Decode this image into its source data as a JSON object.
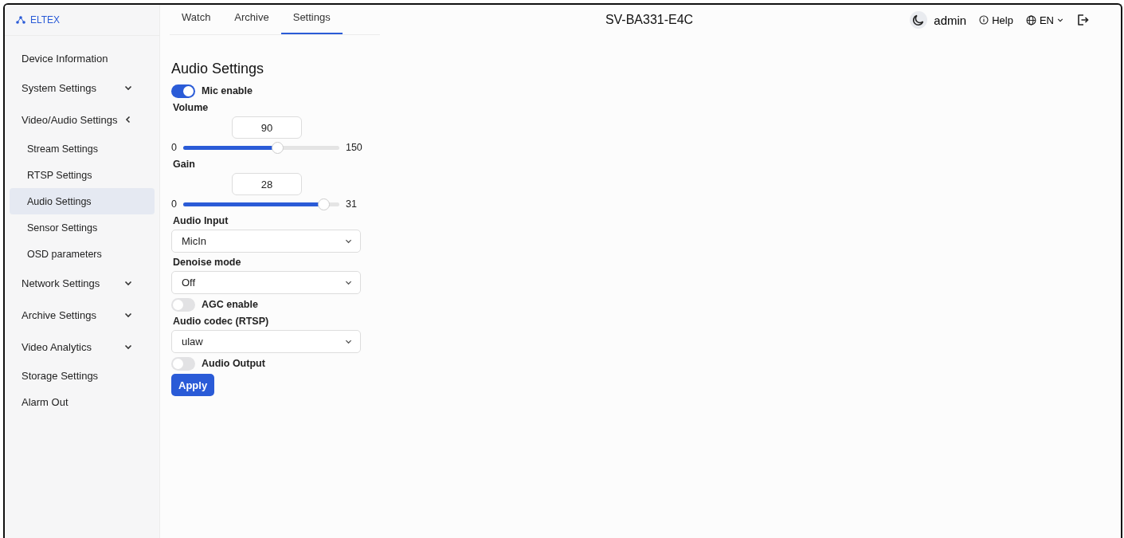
{
  "brand": "ELTEX",
  "tabs": [
    {
      "label": "Watch",
      "selected": false
    },
    {
      "label": "Archive",
      "selected": false
    },
    {
      "label": "Settings",
      "selected": true
    }
  ],
  "device_name": "SV-BA331-E4C",
  "user": "admin",
  "help": "Help",
  "language": "EN",
  "sidebar": {
    "items": [
      {
        "kind": "link",
        "label": "Device Information",
        "selected": false
      },
      {
        "kind": "group",
        "label": "System Settings",
        "expanded": false
      },
      {
        "kind": "group",
        "label": "Video/Audio Settings",
        "expanded": true,
        "children": [
          {
            "label": "Stream Settings",
            "selected": false
          },
          {
            "label": "RTSP Settings",
            "selected": false
          },
          {
            "label": "Audio Settings",
            "selected": true
          },
          {
            "label": "Sensor Settings",
            "selected": false
          },
          {
            "label": "OSD parameters",
            "selected": false
          }
        ]
      },
      {
        "kind": "group",
        "label": "Network Settings",
        "expanded": false
      },
      {
        "kind": "group",
        "label": "Archive Settings",
        "expanded": false
      },
      {
        "kind": "group",
        "label": "Video Analytics",
        "expanded": false
      },
      {
        "kind": "link",
        "label": "Storage Settings",
        "selected": false
      },
      {
        "kind": "link",
        "label": "Alarm Out",
        "selected": false
      }
    ]
  },
  "form": {
    "title": "Audio Settings",
    "fields": [
      {
        "kind": "toggle",
        "label": "Mic enable",
        "on": true
      },
      {
        "kind": "slider",
        "label": "Volume",
        "value": "90",
        "min": "0",
        "max": "150",
        "level": 0.6
      },
      {
        "kind": "slider",
        "label": "Gain",
        "value": "28",
        "min": "0",
        "max": "31",
        "level": 0.9
      },
      {
        "kind": "select",
        "label": "Audio Input",
        "value": "MicIn"
      },
      {
        "kind": "select",
        "label": "Denoise mode",
        "value": "Off"
      },
      {
        "kind": "toggle",
        "label": "AGC enable",
        "on": false
      },
      {
        "kind": "select",
        "label": "Audio codec (RTSP)",
        "value": "ulaw"
      },
      {
        "kind": "toggle",
        "label": "Audio Output",
        "on": false
      }
    ],
    "apply": "Apply"
  }
}
